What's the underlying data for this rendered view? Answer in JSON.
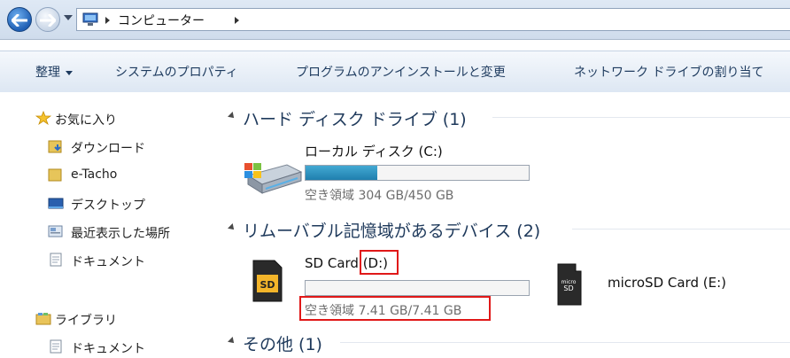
{
  "address": {
    "crumbs": [
      "コンピューター"
    ]
  },
  "toolbar": {
    "organize": "整理",
    "system_properties": "システムのプロパティ",
    "uninstall": "プログラムのアンインストールと変更",
    "map_drive": "ネットワーク ドライブの割り当て"
  },
  "nav": {
    "favorites": "お気に入り",
    "downloads": "ダウンロード",
    "etacho": "e-Tacho",
    "desktop": "デスクトップ",
    "recent": "最近表示した場所",
    "documents": "ドキュメント",
    "libraries": "ライブラリ",
    "lib_documents": "ドキュメント"
  },
  "groups": {
    "hdd_title": "ハード ディスク ドライブ (1)",
    "removable_title": "リムーバブル記憶域があるデバイス (2)",
    "other_title": "その他 (1)"
  },
  "drives": {
    "c": {
      "name": "ローカル ディスク (C:)",
      "free": "空き領域 304 GB/450 GB",
      "used_fraction": 0.32
    },
    "d": {
      "name_prefix": "SD Card ",
      "letter": "(D:)",
      "free": "空き領域 7.41 GB/7.41 GB",
      "used_fraction": 0.0
    },
    "e": {
      "name": "microSD Card (E:)"
    }
  },
  "colors": {
    "accent": "#1e395b",
    "highlight": "#e01818",
    "bar_fill": "#2a8fc0"
  }
}
